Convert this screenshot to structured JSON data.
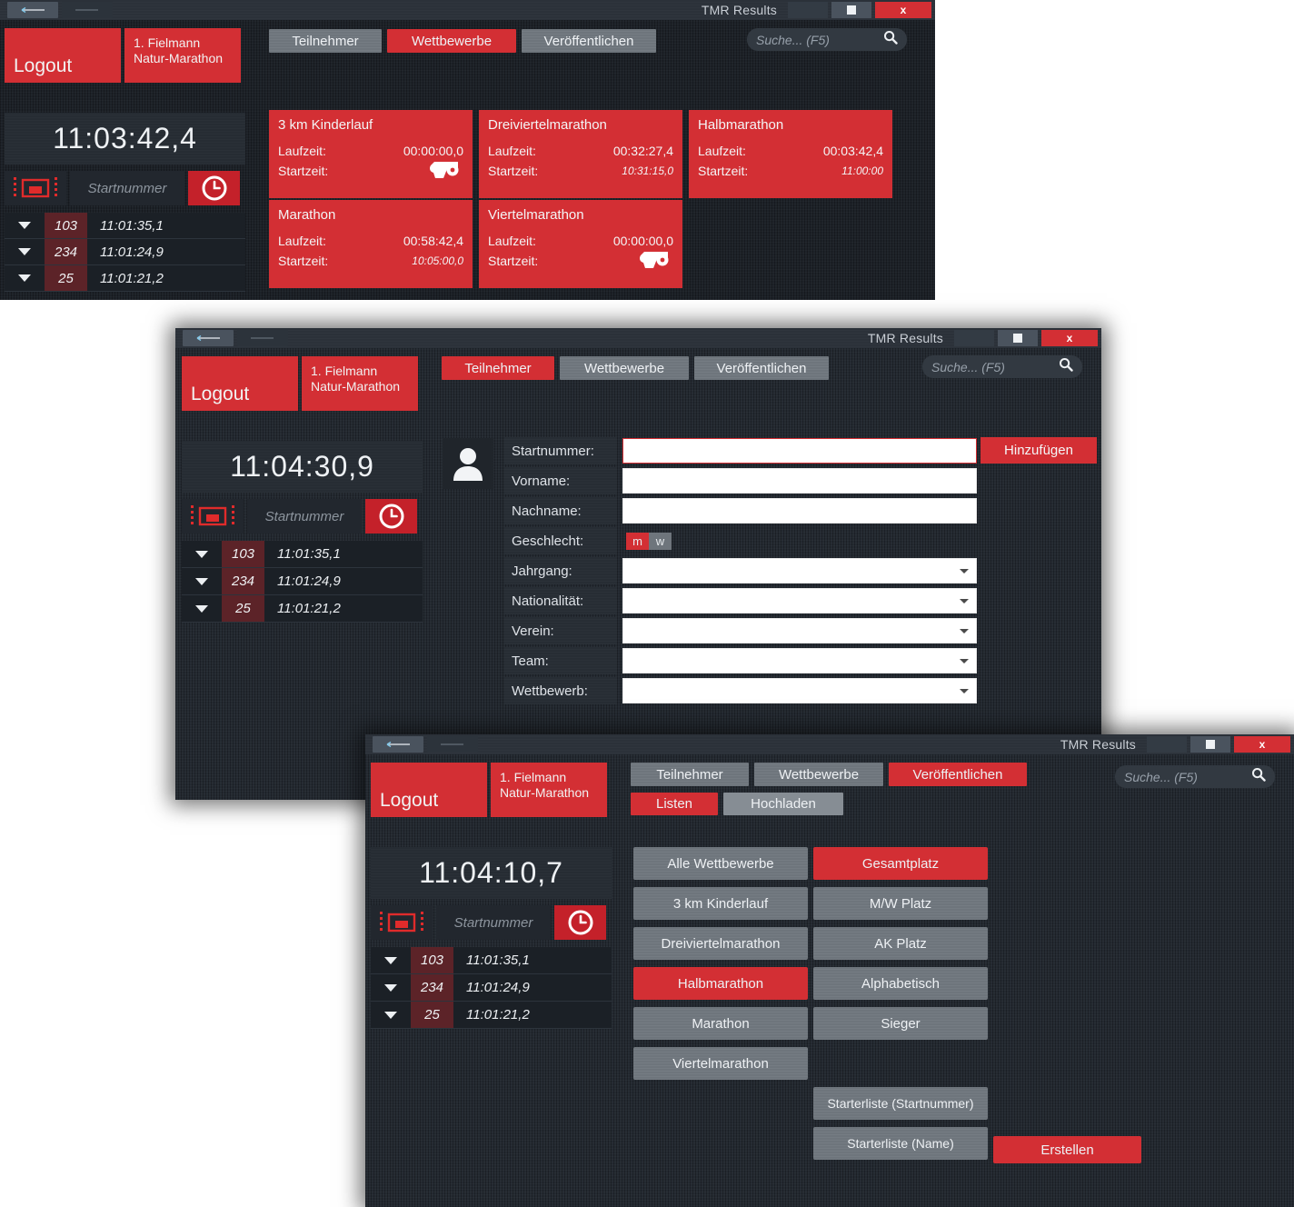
{
  "app": {
    "title": "TMR Results",
    "close_label": "x",
    "logout_label": "Logout",
    "event_name": "1. Fielmann\nNatur-Marathon",
    "event_line1": "1. Fielmann",
    "event_line2": "Natur-Marathon",
    "search_placeholder": "Suche... (F5)",
    "startnummer_placeholder": "Startnummer",
    "accent_color": "#d32f34",
    "panel_color": "#242a31"
  },
  "tabs": {
    "teilnehmer": "Teilnehmer",
    "wettbewerbe": "Wettbewerbe",
    "veroeffentlichen": "Veröffentlichen",
    "listen": "Listen",
    "hochladen": "Hochladen"
  },
  "window1": {
    "clock": "11:03:42,4",
    "active_tab": "Wettbewerbe",
    "timing_list": [
      {
        "number": "103",
        "time": "11:01:35,1"
      },
      {
        "number": "234",
        "time": "11:01:24,9"
      },
      {
        "number": "25",
        "time": "11:01:21,2"
      }
    ],
    "labels": {
      "laufzeit": "Laufzeit:",
      "startzeit": "Startzeit:"
    },
    "competitions": [
      {
        "name": "3 km Kinderlauf",
        "laufzeit": "00:00:00,0",
        "startzeit": "",
        "has_gun": true
      },
      {
        "name": "Dreiviertelmarathon",
        "laufzeit": "00:32:27,4",
        "startzeit": "10:31:15,0",
        "has_gun": false
      },
      {
        "name": "Halbmarathon",
        "laufzeit": "00:03:42,4",
        "startzeit": "11:00:00",
        "has_gun": false
      },
      {
        "name": "Marathon",
        "laufzeit": "00:58:42,4",
        "startzeit": "10:05:00,0",
        "has_gun": false
      },
      {
        "name": "Viertelmarathon",
        "laufzeit": "00:00:00,0",
        "startzeit": "",
        "has_gun": true
      }
    ]
  },
  "window2": {
    "clock": "11:04:30,9",
    "active_tab": "Teilnehmer",
    "timing_list": [
      {
        "number": "103",
        "time": "11:01:35,1"
      },
      {
        "number": "234",
        "time": "11:01:24,9"
      },
      {
        "number": "25",
        "time": "11:01:21,2"
      }
    ],
    "form": {
      "add_button": "Hinzufügen",
      "fields": [
        {
          "label": "Startnummer:",
          "value": "",
          "type": "text",
          "focused": true
        },
        {
          "label": "Vorname:",
          "value": "",
          "type": "text",
          "focused": false
        },
        {
          "label": "Nachname:",
          "value": "",
          "type": "text",
          "focused": false
        },
        {
          "label": "Geschlecht:",
          "value": "m",
          "type": "sex",
          "focused": false
        },
        {
          "label": "Jahrgang:",
          "value": "",
          "type": "select",
          "focused": false
        },
        {
          "label": "Nationalität:",
          "value": "",
          "type": "select",
          "focused": false
        },
        {
          "label": "Verein:",
          "value": "",
          "type": "select",
          "focused": false
        },
        {
          "label": "Team:",
          "value": "",
          "type": "select",
          "focused": false
        },
        {
          "label": "Wettbewerb:",
          "value": "",
          "type": "select",
          "focused": false
        }
      ],
      "sex_male": "m",
      "sex_female": "w"
    }
  },
  "window3": {
    "clock": "11:04:10,7",
    "active_tab": "Veröffentlichen",
    "active_subtab": "Listen",
    "timing_list": [
      {
        "number": "103",
        "time": "11:01:35,1"
      },
      {
        "number": "234",
        "time": "11:01:24,9"
      },
      {
        "number": "25",
        "time": "11:01:21,2"
      }
    ],
    "competition_buttons": [
      {
        "label": "Alle Wettbewerbe",
        "active": false
      },
      {
        "label": "3 km Kinderlauf",
        "active": false
      },
      {
        "label": "Dreiviertelmarathon",
        "active": false
      },
      {
        "label": "Halbmarathon",
        "active": true
      },
      {
        "label": "Marathon",
        "active": false
      },
      {
        "label": "Viertelmarathon",
        "active": false
      }
    ],
    "sort_buttons": [
      {
        "label": "Gesamtplatz",
        "active": true
      },
      {
        "label": "M/W Platz",
        "active": false
      },
      {
        "label": "AK Platz",
        "active": false
      },
      {
        "label": "Alphabetisch",
        "active": false
      },
      {
        "label": "Sieger",
        "active": false
      }
    ],
    "starter_buttons": [
      {
        "label": "Starterliste (Startnummer)",
        "active": false
      },
      {
        "label": "Starterliste (Name)",
        "active": false
      }
    ],
    "create_button": "Erstellen"
  }
}
